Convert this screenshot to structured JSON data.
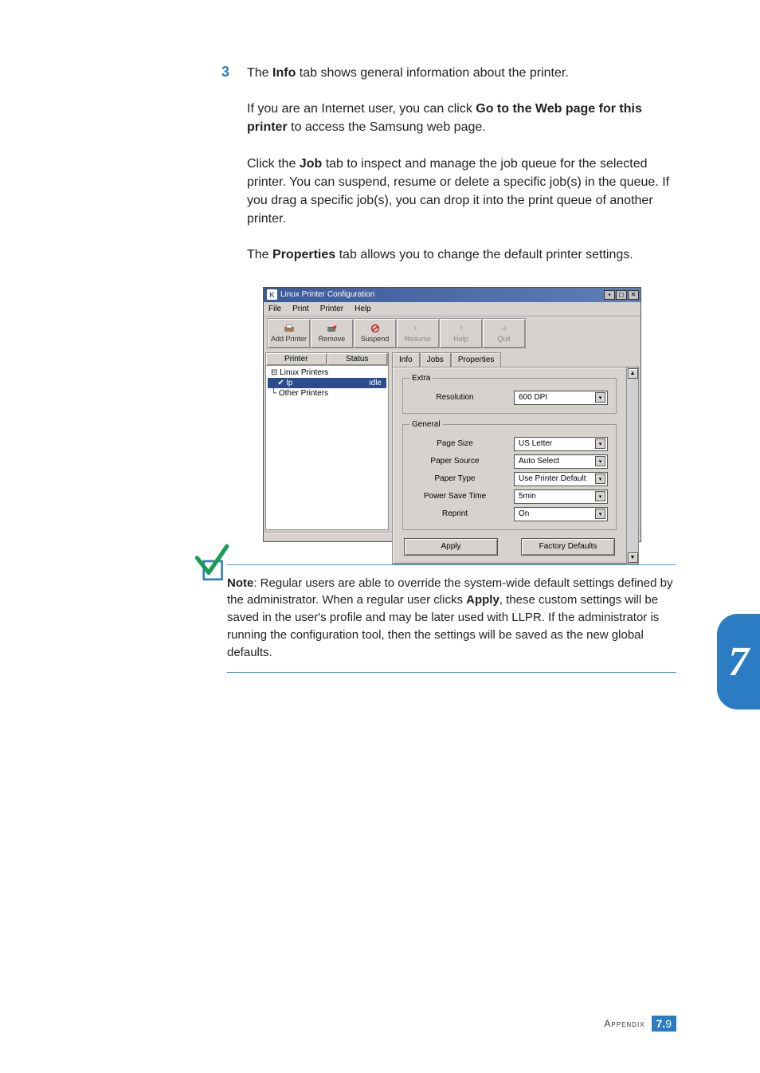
{
  "step_number": "3",
  "paragraphs": {
    "p1_a": "The ",
    "p1_b": "Info",
    "p1_c": " tab shows general information about the printer.",
    "p2_a": "If you are an Internet user, you can click ",
    "p2_b": "Go to the Web page for this printer",
    "p2_c": " to access the Samsung web page.",
    "p3_a": "Click the ",
    "p3_b": "Job",
    "p3_c": " tab to inspect and manage the job queue for the selected printer. You can suspend, resume or delete a specific job(s) in the queue. If you drag a specific job(s), you can drop it into the print queue of another printer.",
    "p4_a": "The ",
    "p4_b": "Properties",
    "p4_c": " tab allows you to change the default printer settings."
  },
  "screenshot": {
    "app_letter": "K",
    "title": "Linux Printer Configuration",
    "menubar": [
      "File",
      "Print",
      "Printer",
      "Help"
    ],
    "toolbar": [
      {
        "label": "Add Printer",
        "disabled": false
      },
      {
        "label": "Remove",
        "disabled": false
      },
      {
        "label": "Suspend",
        "disabled": false
      },
      {
        "label": "Resume",
        "disabled": true
      },
      {
        "label": "Help",
        "disabled": true
      },
      {
        "label": "Quit",
        "disabled": true
      }
    ],
    "tree_headers": [
      "Printer",
      "Status"
    ],
    "tree_items": {
      "root": "Linux Printers",
      "selected_name": "lp",
      "selected_status": "idle",
      "other": "Other Printers"
    },
    "tabs": [
      "Info",
      "Jobs",
      "Properties"
    ],
    "fieldsets": {
      "extra": {
        "legend": "Extra",
        "rows": [
          {
            "label": "Resolution",
            "value": "600 DPI"
          }
        ]
      },
      "general": {
        "legend": "General",
        "rows": [
          {
            "label": "Page Size",
            "value": "US Letter"
          },
          {
            "label": "Paper Source",
            "value": "Auto Select"
          },
          {
            "label": "Paper Type",
            "value": "Use Printer Default"
          },
          {
            "label": "Power Save Time",
            "value": "5min"
          },
          {
            "label": "Reprint",
            "value": "On"
          }
        ]
      }
    },
    "buttons": {
      "apply": "Apply",
      "defaults": "Factory Defaults"
    }
  },
  "note": {
    "label": "Note",
    "text_a": ": Regular users are able to override the system-wide default settings defined by the administrator. When a regular user clicks ",
    "apply": "Apply",
    "text_b": ", these custom settings will be saved in the user's profile and may be later used with LLPR. If the administrator is running the configuration tool, then the settings will be saved as the new global defaults."
  },
  "footer": {
    "section": "Appendix",
    "chapter": "7.",
    "page": "9"
  },
  "side_tab": "7"
}
